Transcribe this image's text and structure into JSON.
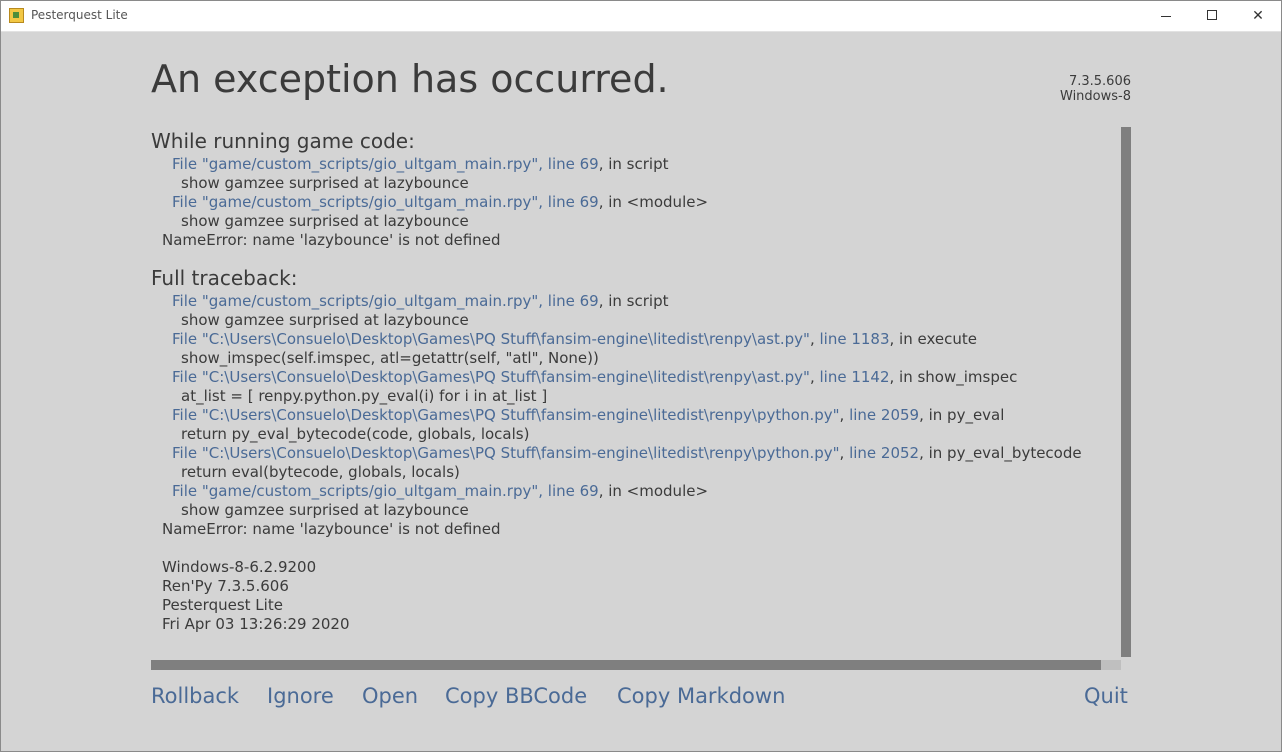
{
  "window": {
    "title": "Pesterquest Lite",
    "controls": {
      "minimize_icon": "minimize-icon",
      "maximize_icon": "maximize-icon",
      "close_icon": "close-icon",
      "close_glyph": "✕"
    }
  },
  "headline": "An exception has occurred.",
  "version": {
    "number": "7.3.5.606",
    "platform": "Windows-8"
  },
  "short": {
    "heading": "While running game code:",
    "lines": [
      {
        "kind": "file",
        "link": "File \"game/custom_scripts/gio_ultgam_main.rpy\", line 69",
        "rest": ", in script"
      },
      {
        "kind": "code",
        "text": "show gamzee surprised at lazybounce"
      },
      {
        "kind": "file",
        "link": "File \"game/custom_scripts/gio_ultgam_main.rpy\", line 69",
        "rest": ", in <module>"
      },
      {
        "kind": "code",
        "text": "show gamzee surprised at lazybounce"
      },
      {
        "kind": "error",
        "text": "NameError: name 'lazybounce' is not defined"
      }
    ]
  },
  "full": {
    "heading": "Full traceback:",
    "lines": [
      {
        "kind": "file",
        "link": "File \"game/custom_scripts/gio_ultgam_main.rpy\", line 69",
        "rest": ", in script"
      },
      {
        "kind": "code",
        "text": "show gamzee surprised at lazybounce"
      },
      {
        "kind": "file2",
        "link": "File \"C:\\Users\\Consuelo\\Desktop\\Games\\PQ Stuff\\fansim-engine\\litedist\\renpy\\ast.py\"",
        "sep": ", ",
        "link2": "line 1183",
        "rest": ", in execute"
      },
      {
        "kind": "code",
        "text": "show_imspec(self.imspec, atl=getattr(self, \"atl\", None))"
      },
      {
        "kind": "file2",
        "link": "File \"C:\\Users\\Consuelo\\Desktop\\Games\\PQ Stuff\\fansim-engine\\litedist\\renpy\\ast.py\"",
        "sep": ", ",
        "link2": "line 1142",
        "rest": ", in show_imspec"
      },
      {
        "kind": "code",
        "text": "at_list = [ renpy.python.py_eval(i) for i in at_list ]"
      },
      {
        "kind": "file2",
        "link": "File \"C:\\Users\\Consuelo\\Desktop\\Games\\PQ Stuff\\fansim-engine\\litedist\\renpy\\python.py\"",
        "sep": ", ",
        "link2": "line 2059",
        "rest": ", in py_eval"
      },
      {
        "kind": "code",
        "text": "return py_eval_bytecode(code, globals, locals)"
      },
      {
        "kind": "file2",
        "link": "File \"C:\\Users\\Consuelo\\Desktop\\Games\\PQ Stuff\\fansim-engine\\litedist\\renpy\\python.py\"",
        "sep": ", ",
        "link2": "line 2052",
        "rest": ", in py_eval_bytecode"
      },
      {
        "kind": "code",
        "text": "return eval(bytecode, globals, locals)"
      },
      {
        "kind": "file",
        "link": "File \"game/custom_scripts/gio_ultgam_main.rpy\", line 69",
        "rest": ", in <module>"
      },
      {
        "kind": "code",
        "text": "show gamzee surprised at lazybounce"
      },
      {
        "kind": "error",
        "text": "NameError: name 'lazybounce' is not defined"
      }
    ]
  },
  "system_info": [
    "Windows-8-6.2.9200",
    "Ren'Py 7.3.5.606",
    "Pesterquest Lite",
    "Fri Apr 03 13:26:29 2020"
  ],
  "actions": {
    "rollback": "Rollback",
    "ignore": "Ignore",
    "open": "Open",
    "copy_bbcode": "Copy BBCode",
    "copy_markdown": "Copy Markdown",
    "quit": "Quit"
  }
}
